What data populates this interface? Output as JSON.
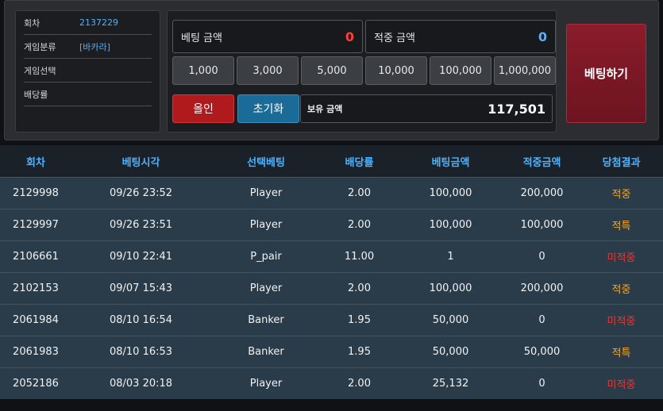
{
  "info": {
    "round_label": "회차",
    "round_value": "2137229",
    "category_label": "게임분류",
    "category_value": "[바카라]",
    "selection_label": "게임선택",
    "selection_value": "",
    "odds_label": "배당률",
    "odds_value": ""
  },
  "bet": {
    "bet_amount_label": "베팅 금액",
    "bet_amount_value": "0",
    "win_amount_label": "적중 금액",
    "win_amount_value": "0",
    "chips": [
      "1,000",
      "3,000",
      "5,000",
      "10,000",
      "100,000",
      "1,000,000"
    ],
    "allin_label": "올인",
    "reset_label": "초기화",
    "balance_label": "보유 금액",
    "balance_value": "117,501",
    "place_bet_label": "베팅하기"
  },
  "colors": {
    "bet_amount": "#ff3b3b",
    "win_amount": "#4db2ff",
    "win_result": "#f5a623",
    "lose_result": "#e53935"
  },
  "table": {
    "headers": [
      "회차",
      "베팅시각",
      "선택베팅",
      "배당률",
      "베팅금액",
      "적중금액",
      "당첨결과"
    ],
    "rows": [
      [
        "2129998",
        "09/26 23:52",
        "Player",
        "2.00",
        "100,000",
        "200,000",
        "적중",
        "win"
      ],
      [
        "2129997",
        "09/26 23:51",
        "Player",
        "2.00",
        "100,000",
        "100,000",
        "적특",
        "win"
      ],
      [
        "2106661",
        "09/10 22:41",
        "P_pair",
        "11.00",
        "1",
        "0",
        "미적중",
        "lose"
      ],
      [
        "2102153",
        "09/07 15:43",
        "Player",
        "2.00",
        "100,000",
        "200,000",
        "적중",
        "win"
      ],
      [
        "2061984",
        "08/10 16:54",
        "Banker",
        "1.95",
        "50,000",
        "0",
        "미적중",
        "lose"
      ],
      [
        "2061983",
        "08/10 16:53",
        "Banker",
        "1.95",
        "50,000",
        "50,000",
        "적특",
        "win"
      ],
      [
        "2052186",
        "08/03 20:18",
        "Player",
        "2.00",
        "25,132",
        "0",
        "미적중",
        "lose"
      ]
    ]
  }
}
